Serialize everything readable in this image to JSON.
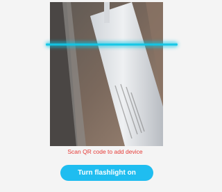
{
  "scanner": {
    "hint": "Scan QR code to add device",
    "camera_feed_image": "camera-preview-of-device-label",
    "scan_line_color": "#11c6e6"
  },
  "actions": {
    "flashlight_label": "Turn flashlight on",
    "button_color": "#1fbdf0"
  },
  "colors": {
    "hint": "#e53935",
    "background": "#f4f4f4"
  }
}
